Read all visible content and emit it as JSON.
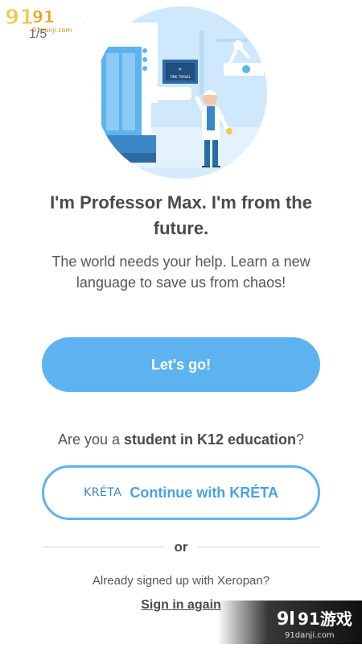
{
  "watermark": {
    "logo_text": "91游戏",
    "site": "91danji.com"
  },
  "onboarding": {
    "pager": "1/5",
    "title": "I'm Professor Max. I'm from the future.",
    "subtitle": "The world needs your help. Learn a new language to save us from chaos!",
    "hero_sign": "TIME TRAVEL",
    "start_button": "Let's go!"
  },
  "k12": {
    "question_prefix": "Are you a ",
    "question_bold": "student in K12 education",
    "question_suffix": "?",
    "kreta_logo": "KRÉTA",
    "kreta_button": "Continue with KRÉTA"
  },
  "signin": {
    "or": "or",
    "already": "Already signed up with Xeropan?",
    "link": "Sign in again"
  },
  "colors": {
    "accent": "#5db3ef",
    "text": "#4a4a4a",
    "hero_bg": "#cfe8fb"
  },
  "icons": [
    "illustration-professor-max",
    "kreta-logo-icon"
  ]
}
